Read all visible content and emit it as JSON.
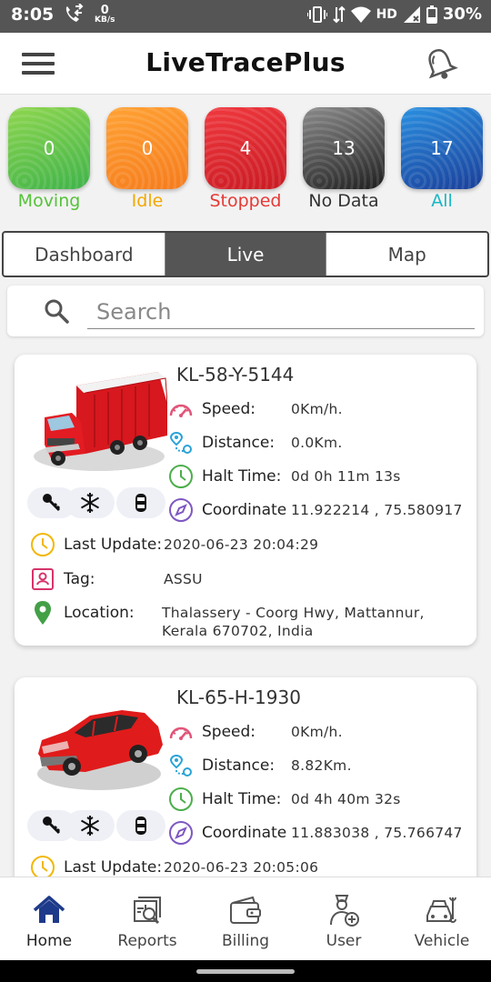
{
  "status_bar": {
    "time": "8:05",
    "kbs_value": "0",
    "kbs_unit": "KB/s",
    "network": "HD",
    "battery": "30%"
  },
  "header": {
    "title": "LiveTracePlus"
  },
  "status_tiles": [
    {
      "count": "0",
      "label": "Moving",
      "color": "#5cc43a",
      "label_color": "#56c23a"
    },
    {
      "count": "0",
      "label": "Idle",
      "color": "#ff8a1f",
      "label_color": "#f2a800"
    },
    {
      "count": "4",
      "label": "Stopped",
      "color": "#e0242a",
      "label_color": "#e53935"
    },
    {
      "count": "13",
      "label": "No Data",
      "color": "#2e2e2e",
      "label_color": "#333333"
    },
    {
      "count": "17",
      "label": "All",
      "color": "#1e6fd0",
      "label_color": "#17b8c4"
    }
  ],
  "tabs": [
    {
      "label": "Dashboard",
      "active": false
    },
    {
      "label": "Live",
      "active": true
    },
    {
      "label": "Map",
      "active": false
    }
  ],
  "search": {
    "placeholder": "Search"
  },
  "labels": {
    "speed": "Speed:",
    "distance": "Distance:",
    "halt_time": "Halt Time:",
    "coordinate": "Coordinate",
    "last_update": "Last Update:",
    "tag": "Tag:",
    "location": "Location:"
  },
  "vehicles": [
    {
      "plate": "KL-58-Y-5144",
      "type": "truck",
      "speed": "0Km/h.",
      "distance": "0.0Km.",
      "halt_time": "0d 0h 11m 13s",
      "coordinate": "11.922214 , 75.580917",
      "last_update": "2020-06-23 20:04:29",
      "tag": "ASSU",
      "location": "Thalassery - Coorg Hwy, Mattannur, Kerala 670702, India"
    },
    {
      "plate": "KL-65-H-1930",
      "type": "car",
      "speed": "0Km/h.",
      "distance": "8.82Km.",
      "halt_time": "0d 4h 40m 32s",
      "coordinate": "11.883038 , 75.766747",
      "last_update": "2020-06-23 20:05:06"
    }
  ],
  "bottom_nav": [
    {
      "label": "Home",
      "icon": "home-icon",
      "active": true
    },
    {
      "label": "Reports",
      "icon": "reports-icon"
    },
    {
      "label": "Billing",
      "icon": "wallet-icon"
    },
    {
      "label": "User",
      "icon": "user-add-icon"
    },
    {
      "label": "Vehicle",
      "icon": "car-wrench-icon"
    }
  ]
}
